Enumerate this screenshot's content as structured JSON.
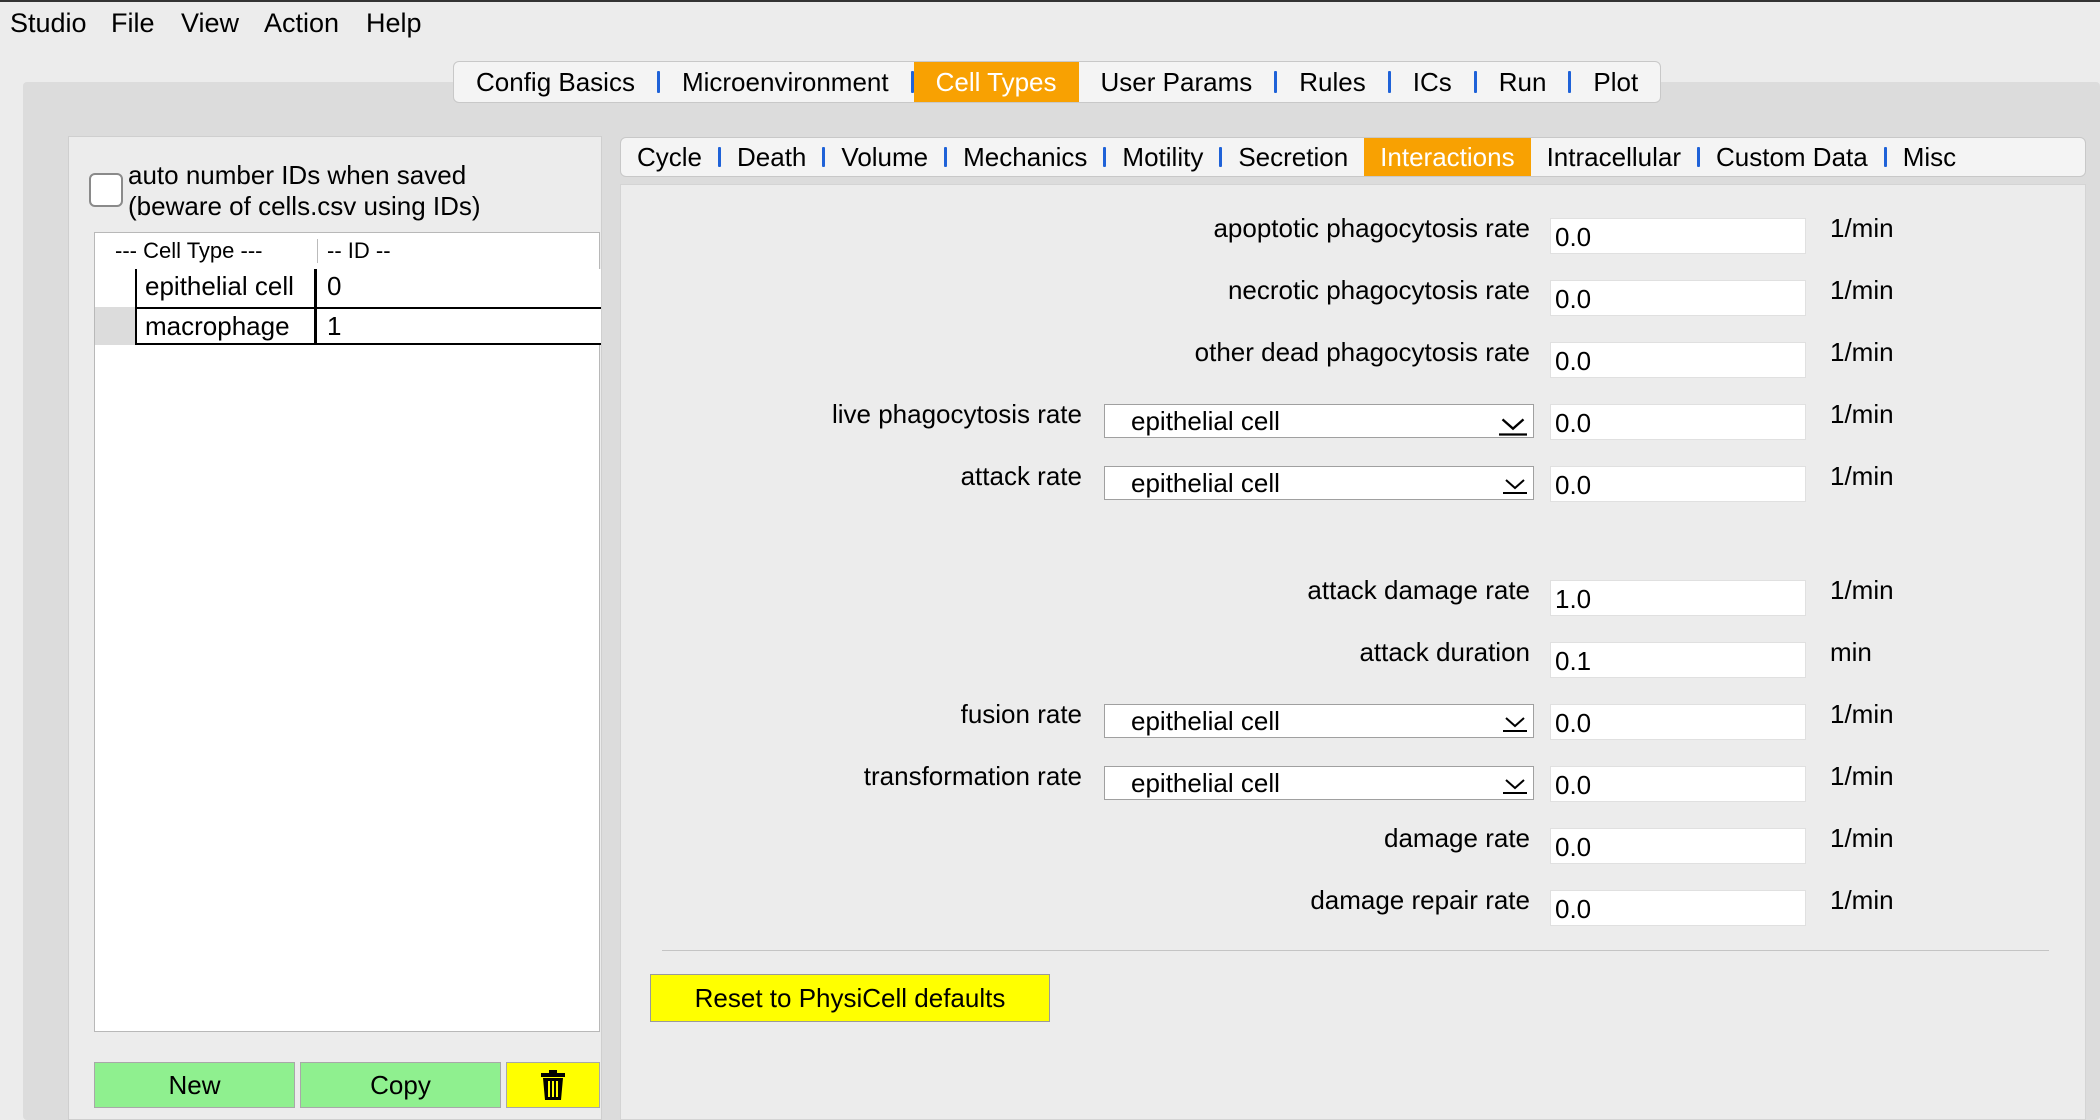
{
  "menubar": {
    "items": [
      "Studio",
      "File",
      "View",
      "Action",
      "Help"
    ]
  },
  "top_tabs": {
    "items": [
      "Config Basics",
      "Microenvironment",
      "Cell Types",
      "User Params",
      "Rules",
      "ICs",
      "Run",
      "Plot"
    ],
    "active": "Cell Types"
  },
  "left": {
    "auto_number_label_1": "auto number IDs when saved",
    "auto_number_label_2": "(beware of cells.csv using IDs)",
    "auto_number_checked": false,
    "table": {
      "header_type": "---  Cell Type ---",
      "header_id": "-- ID --",
      "rows": [
        {
          "name": "epithelial cell",
          "id": "0"
        },
        {
          "name": "macrophage",
          "id": "1"
        }
      ]
    },
    "buttons": {
      "new": "New",
      "copy": "Copy",
      "delete_icon": "trash-icon"
    }
  },
  "sub_tabs": {
    "items": [
      "Cycle",
      "Death",
      "Volume",
      "Mechanics",
      "Motility",
      "Secretion",
      "Interactions",
      "Intracellular",
      "Custom Data",
      "Misc"
    ],
    "active": "Interactions"
  },
  "interactions": {
    "apoptotic_phagocytosis": {
      "label": "apoptotic phagocytosis rate",
      "value": "0.0",
      "unit": "1/min"
    },
    "necrotic_phagocytosis": {
      "label": "necrotic phagocytosis rate",
      "value": "0.0",
      "unit": "1/min"
    },
    "other_dead_phagocytosis": {
      "label": "other dead phagocytosis rate",
      "value": "0.0",
      "unit": "1/min"
    },
    "live_phagocytosis": {
      "label": "live phagocytosis rate",
      "select": "epithelial cell",
      "value": "0.0",
      "unit": "1/min"
    },
    "attack": {
      "label": "attack rate",
      "select": "epithelial cell",
      "value": "0.0",
      "unit": "1/min"
    },
    "attack_damage": {
      "label": "attack damage rate",
      "value": "1.0",
      "unit": "1/min"
    },
    "attack_duration": {
      "label": "attack duration",
      "value": "0.1",
      "unit": "min"
    },
    "fusion": {
      "label": "fusion rate",
      "select": "epithelial cell",
      "value": "0.0",
      "unit": "1/min"
    },
    "transformation": {
      "label": "transformation rate",
      "select": "epithelial cell",
      "value": "0.0",
      "unit": "1/min"
    },
    "damage": {
      "label": "damage rate",
      "value": "0.0",
      "unit": "1/min"
    },
    "damage_repair": {
      "label": "damage repair rate",
      "value": "0.0",
      "unit": "1/min"
    },
    "reset_button": "Reset to PhysiCell defaults"
  },
  "colors": {
    "active_tab": "#f8a102",
    "tab_separator": "#1f62d8",
    "green_button": "#8ff08f",
    "yellow_button": "#ffff00"
  }
}
